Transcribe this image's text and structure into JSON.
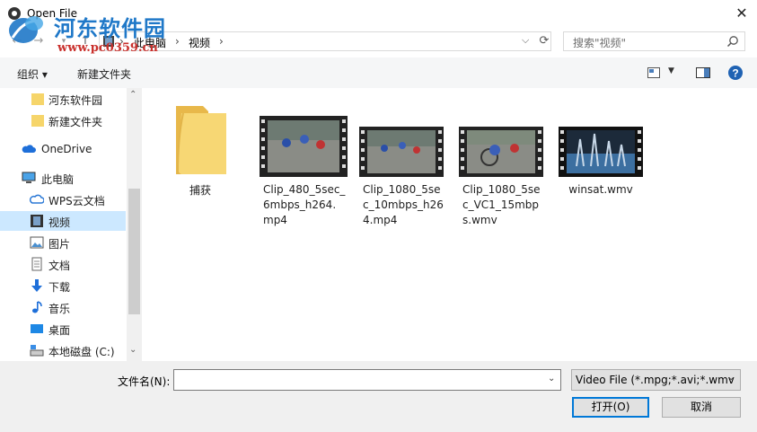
{
  "window": {
    "title": "Open File",
    "close_glyph": "✕"
  },
  "watermark": {
    "name": "河东软件园",
    "url": "www.pc0359.cn"
  },
  "nav": {
    "back": "←",
    "forward": "→",
    "up": "↑",
    "breadcrumb": [
      "此电脑",
      "视频"
    ],
    "separator": "›",
    "search_placeholder": "搜索\"视频\""
  },
  "toolbar": {
    "organize": "组织 ▾",
    "new_folder": "新建文件夹"
  },
  "sidebar": {
    "items": [
      {
        "label": "河东软件园",
        "icon": "folder-icon"
      },
      {
        "label": "新建文件夹",
        "icon": "folder-icon"
      },
      {
        "label": "OneDrive",
        "icon": "cloud-icon"
      },
      {
        "label": "此电脑",
        "icon": "computer-icon"
      },
      {
        "label": "WPS云文档",
        "icon": "cloud-outline-icon"
      },
      {
        "label": "视频",
        "icon": "video-icon"
      },
      {
        "label": "图片",
        "icon": "picture-icon"
      },
      {
        "label": "文档",
        "icon": "document-icon"
      },
      {
        "label": "下载",
        "icon": "download-icon"
      },
      {
        "label": "音乐",
        "icon": "music-icon"
      },
      {
        "label": "桌面",
        "icon": "desktop-icon"
      },
      {
        "label": "本地磁盘 (C:)",
        "icon": "drive-icon"
      }
    ]
  },
  "files": [
    {
      "name": "捕获",
      "type": "folder"
    },
    {
      "name": "Clip_480_5sec_6mbps_h264.mp4",
      "type": "video"
    },
    {
      "name": "Clip_1080_5sec_10mbps_h264.mp4",
      "type": "video"
    },
    {
      "name": "Clip_1080_5sec_VC1_15mbps.wmv",
      "type": "video"
    },
    {
      "name": "winsat.wmv",
      "type": "video"
    }
  ],
  "bottom": {
    "filename_label": "文件名(N):",
    "filename_value": "",
    "filter_value": "Video File (*.mpg;*.avi;*.wmv",
    "open_label": "打开(O)",
    "cancel_label": "取消"
  }
}
